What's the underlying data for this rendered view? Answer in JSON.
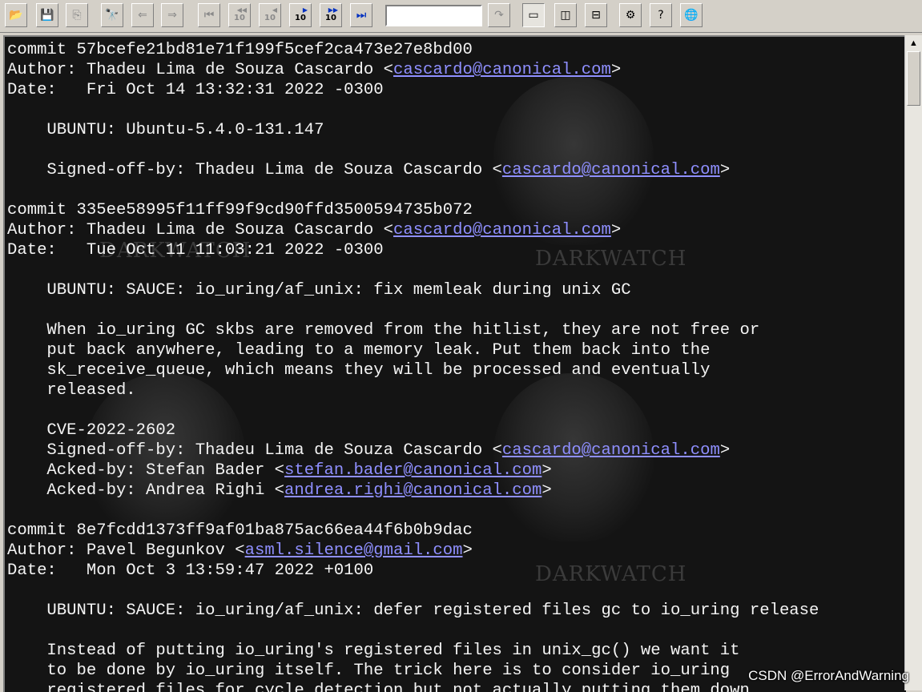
{
  "toolbar": {
    "search_value": "",
    "icons": [
      "open-folder",
      "save",
      "copy",
      "find",
      "find-prev",
      "find-next",
      "first",
      "back-10",
      "back-1",
      "forward-1",
      "forward-10",
      "last",
      "go",
      "view-full",
      "view-split-v",
      "view-split-h",
      "settings",
      "help",
      "web"
    ]
  },
  "log": {
    "lines": [
      {
        "text": "commit 57bcefe21bd81e71f199f5cef2ca473e27e8bd00"
      },
      {
        "text": "Author: Thadeu Lima de Souza Cascardo <",
        "link": "cascardo@canonical.com",
        "after": ">"
      },
      {
        "text": "Date:   Fri Oct 14 13:32:31 2022 -0300"
      },
      {
        "text": ""
      },
      {
        "text": "    UBUNTU: Ubuntu-5.4.0-131.147"
      },
      {
        "text": ""
      },
      {
        "text": "    Signed-off-by: Thadeu Lima de Souza Cascardo <",
        "link": "cascardo@canonical.com",
        "after": ">"
      },
      {
        "text": ""
      },
      {
        "text": "commit 335ee58995f11ff99f9cd90ffd3500594735b072"
      },
      {
        "text": "Author: Thadeu Lima de Souza Cascardo <",
        "link": "cascardo@canonical.com",
        "after": ">"
      },
      {
        "text": "Date:   Tue Oct 11 11:03:21 2022 -0300"
      },
      {
        "text": ""
      },
      {
        "text": "    UBUNTU: SAUCE: io_uring/af_unix: fix memleak during unix GC"
      },
      {
        "text": ""
      },
      {
        "text": "    When io_uring GC skbs are removed from the hitlist, they are not free or"
      },
      {
        "text": "    put back anywhere, leading to a memory leak. Put them back into the"
      },
      {
        "text": "    sk_receive_queue, which means they will be processed and eventually"
      },
      {
        "text": "    released."
      },
      {
        "text": ""
      },
      {
        "text": "    CVE-2022-2602"
      },
      {
        "text": "    Signed-off-by: Thadeu Lima de Souza Cascardo <",
        "link": "cascardo@canonical.com",
        "after": ">"
      },
      {
        "text": "    Acked-by: Stefan Bader <",
        "link": "stefan.bader@canonical.com",
        "after": ">"
      },
      {
        "text": "    Acked-by: Andrea Righi <",
        "link": "andrea.righi@canonical.com",
        "after": ">"
      },
      {
        "text": ""
      },
      {
        "text": "commit 8e7fcdd1373ff9af01ba875ac66ea44f6b0b9dac"
      },
      {
        "text": "Author: Pavel Begunkov <",
        "link": "asml.silence@gmail.com",
        "after": ">"
      },
      {
        "text": "Date:   Mon Oct 3 13:59:47 2022 +0100"
      },
      {
        "text": ""
      },
      {
        "text": "    UBUNTU: SAUCE: io_uring/af_unix: defer registered files gc to io_uring release"
      },
      {
        "text": ""
      },
      {
        "text": "    Instead of putting io_uring's registered files in unix_gc() we want it"
      },
      {
        "text": "    to be done by io_uring itself. The trick here is to consider io_uring"
      },
      {
        "text": "    registered files for cycle detection but not actually putting them down."
      }
    ]
  },
  "background": {
    "brand_text": "DARKWATCH"
  },
  "watermark": "CSDN @ErrorAndWarning",
  "colors": {
    "link": "#8f8fff",
    "text": "#f4f4f4",
    "background": "#141414"
  }
}
